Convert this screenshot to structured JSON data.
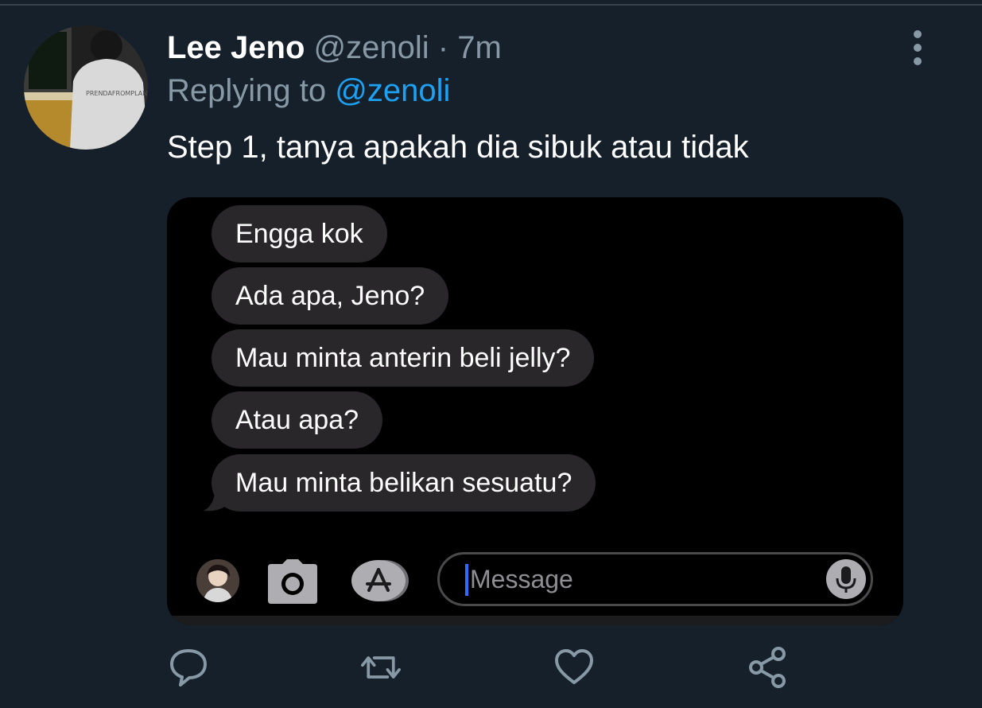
{
  "tweet": {
    "display_name": "Lee Jeno",
    "handle": "@zenoli",
    "separator": "·",
    "time": "7m",
    "replying_prefix": "Replying to ",
    "replying_to": "@zenoli",
    "text": "Step 1, tanya apakah dia sibuk atau tidak",
    "avatar_shirt_text": "PRENDAFROMPLANT"
  },
  "chat": {
    "messages": [
      "Engga kok",
      "Ada apa, Jeno?",
      "Mau minta anterin beli jelly?",
      "Atau apa?",
      "Mau minta belikan sesuatu?"
    ],
    "composer_placeholder": "Message"
  },
  "actions": {
    "icons": [
      "reply-icon",
      "retweet-icon",
      "like-icon",
      "share-icon"
    ]
  },
  "colors": {
    "background": "#15202b",
    "secondary_text": "#8899a6",
    "mention": "#1da1f2",
    "bubble": "#2a272a"
  }
}
